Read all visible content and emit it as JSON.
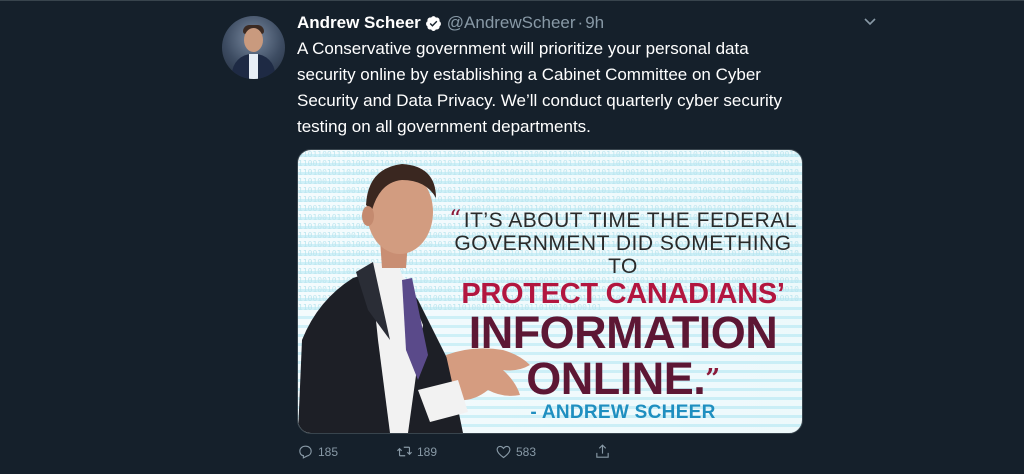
{
  "tweet": {
    "display_name": "Andrew Scheer",
    "handle": "@AndrewScheer",
    "separator": "·",
    "time": "9h",
    "text": "A Conservative government will prioritize your personal data security online by establishing a Cabinet Committee on Cyber Security and Data Privacy. We’ll conduct quarterly cyber security testing on all government departments.",
    "verified": true
  },
  "media": {
    "quote_line1": "IT’S ABOUT TIME THE FEDERAL",
    "quote_open": "“",
    "quote_line2": "GOVERNMENT DID SOMETHING TO",
    "quote_line3": "PROTECT CANADIANS’",
    "quote_line4": "INFORMATION",
    "quote_line5": "ONLINE.",
    "quote_close": "”",
    "attribution": "- ANDREW SCHEER",
    "bit_pattern": "0101100111010100101101001101011010010110100101101001011010011010110010101101001011010010110100101101001011001010110100101101001011010010110100101100101011010010110100101101001011010010110010101101001011010010110100101101001011001010110100101101001011010010110100101100101011010010110100101101001011010010110010101101001011010010110100101101001011001010110100101101001011010010110100101100101011010010110100101101001011010010110010101101001011010010110100101101001011001010110100101101001011010010110100101100101011010010110100101101001011010010110010101101001011010010110100101101001011001010110100101101001011010010110100101100101011010010110100101101001011010010110010101101001011010010110100101101001011001010110100101101001011010010110100101100101011010010110100101101001011010010110010101101001011010010110100101101001011001010110100101101001011010010110100101100101011010010110100101101001011010010110010101101001011010010110100101101001011001010110100101101001011010010110100101100101011010010110100101101001011010010110010101101001011010010110100101101001011001010110100101101001011010010110100101100101011010010110100101101001011010010110010101101001011010010110100101101001011001010110100101101001011010010110100101100101011010010110100101101001011010010110010101101001011010010110100101101001011001010110100101101001011010010110100101100101011010010110100101101001011010010110010101101001011010010110100101101001011001010110100101101001011010010110100101100101011010010110100101101001011010010110010101101001011010010110100101101001011001010110100101101001011010010110100101100101011010010110100101101001011010010110010101101001011010010110100101101001011001010110100101101001011010010110100101100101011010010110100101101001011010010110010101101001011010010110100101101001011001010110100101101001011010010110100101100101"
  },
  "actions": {
    "replies": "185",
    "retweets": "189",
    "likes": "583"
  },
  "icons": {
    "reply": "reply-icon",
    "retweet": "retweet-icon",
    "like": "heart-icon",
    "share": "share-icon",
    "verified": "verified-badge-icon",
    "caret": "chevron-down-icon"
  },
  "colors": {
    "background": "#15202b",
    "muted": "#8899a6",
    "verified": "#ffffff",
    "quote_red": "#b2163f",
    "quote_maroon": "#5d1734",
    "attribution_blue": "#1f8fc0"
  }
}
